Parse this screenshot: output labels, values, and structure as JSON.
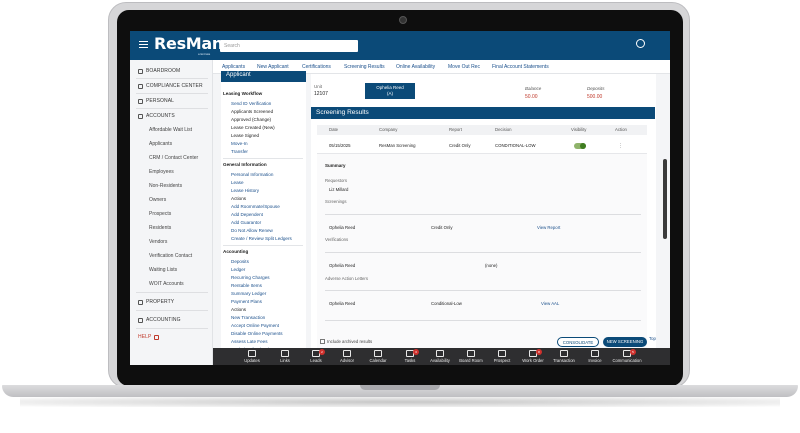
{
  "app": {
    "logo": "ResMan",
    "logo_sub": "a Entrata",
    "search_placeholder": "Search"
  },
  "sidebar": {
    "items": [
      {
        "label": "BOARDROOM",
        "icon": "grid-icon"
      },
      {
        "label": "COMPLIANCE CENTER",
        "icon": "document-icon"
      },
      {
        "label": "PERSONAL",
        "icon": "person-icon"
      },
      {
        "label": "ACCOUNTS",
        "icon": "people-icon"
      },
      {
        "label": "Affordable Wait List",
        "sub": true
      },
      {
        "label": "Applicants",
        "sub": true
      },
      {
        "label": "CRM / Contact Center",
        "sub": true
      },
      {
        "label": "Employees",
        "sub": true
      },
      {
        "label": "Non-Residents",
        "sub": true
      },
      {
        "label": "Owners",
        "sub": true
      },
      {
        "label": "Prospects",
        "sub": true
      },
      {
        "label": "Residents",
        "sub": true
      },
      {
        "label": "Vendors",
        "sub": true
      },
      {
        "label": "Verification Contact",
        "sub": true
      },
      {
        "label": "Waiting Lists",
        "sub": true
      },
      {
        "label": "WOIT Accounts",
        "sub": true
      },
      {
        "label": "PROPERTY",
        "icon": "building-icon"
      },
      {
        "label": "ACCOUNTING",
        "icon": "coin-icon"
      },
      {
        "label": "HELP",
        "icon": "external-link-icon"
      }
    ]
  },
  "tabs": [
    "Applicants",
    "New Applicant",
    "Certifications",
    "Screening Results",
    "Online Availability",
    "Move Out Rec",
    "Final Account Statements"
  ],
  "workflow": {
    "header": "Applicant",
    "sections": [
      {
        "title": "Leasing Workflow",
        "lines": [
          "Send ID Verification",
          "Applicants Screened",
          "Approved (Change)",
          "Lease Created (New)",
          "Lease Signed",
          "Move-In",
          "Transfer"
        ]
      },
      {
        "title": "General Information",
        "lines": [
          "Personal Information",
          "Lease",
          "Lease History",
          "Actions",
          "Add Roommate/Spouse",
          "Add Dependent",
          "Add Guarantor",
          "Do Not Allow Renew",
          "Create / Review Split Ledgers"
        ]
      },
      {
        "title": "Accounting",
        "lines": [
          "Deposits",
          "Ledger",
          "Recurring Charges",
          "Rentable Items",
          "Summary Ledger",
          "Payment Plans",
          "Actions",
          "New Transaction",
          "Accept Online Payment",
          "Disable Online Payments",
          "Assess Late Fees",
          "Apply / Refund Balance"
        ]
      }
    ]
  },
  "main": {
    "unit_label": "Unit",
    "unit_value": "12107",
    "tenant_chip_line1": "Ophelia Reed",
    "tenant_chip_line2": "(A)",
    "balance_label": "Balance",
    "balance_value": "50.00",
    "deposits_label": "Deposits",
    "deposits_value": "500.00",
    "screening_title": "Screening Results",
    "table_headers": [
      "Date",
      "Company",
      "Report",
      "Decision",
      "Visibility",
      "Action"
    ],
    "row": {
      "date": "05/15/2025",
      "company": "ResMan Screening",
      "report": "Credit Only",
      "decision": "CONDITIONAL-LOW"
    },
    "detail": {
      "summary_label": "Summary",
      "requestors_label": "Requestors",
      "requestor": "Liz Millard",
      "screenings_label": "Screenings",
      "screening_name": "Ophelia Reed",
      "screening_type": "Credit Only",
      "view_report": "View Report",
      "verifications_label": "Verifications",
      "verif_name": "Ophelia Reed",
      "verif_value": "(none)",
      "adverse_label": "Adverse Action Letters",
      "adverse_name": "Ophelia Reed",
      "adverse_value": "Conditional-Low",
      "view_aal": "View AAL"
    },
    "include_archived": "Include archived results",
    "consolidate_button": "CONSOLIDATE",
    "new_screening_button": "NEW SCREENING",
    "top_link": "Top"
  },
  "taskbar": [
    {
      "label": "Updates",
      "icon": "megaphone-icon",
      "badge": ""
    },
    {
      "label": "Links",
      "icon": "link-icon",
      "badge": ""
    },
    {
      "label": "Leads",
      "icon": "filter-icon",
      "badge": "2"
    },
    {
      "label": "Advisor",
      "icon": "list-icon",
      "badge": ""
    },
    {
      "label": "Calendar",
      "icon": "calendar-icon",
      "badge": ""
    },
    {
      "label": "Tasks",
      "icon": "tasks-icon",
      "badge": "3"
    },
    {
      "label": "Availability",
      "icon": "bars-icon",
      "badge": ""
    },
    {
      "label": "Board Room",
      "icon": "chart-icon",
      "badge": ""
    },
    {
      "label": "Prospect",
      "icon": "person-icon",
      "badge": ""
    },
    {
      "label": "Work Order",
      "icon": "wrench-icon",
      "badge": "8"
    },
    {
      "label": "Transaction",
      "icon": "monitor-icon",
      "badge": ""
    },
    {
      "label": "Invoice",
      "icon": "invoice-icon",
      "badge": ""
    },
    {
      "label": "Communication",
      "icon": "chat-icon",
      "badge": "5"
    }
  ]
}
